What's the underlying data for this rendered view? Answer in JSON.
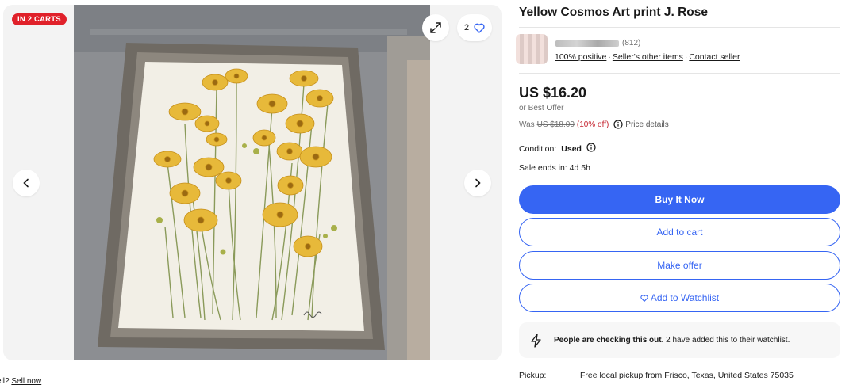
{
  "gallery": {
    "badge": "IN 2 CARTS",
    "watch_count": "2",
    "icons": {
      "expand": "expand-icon",
      "heart": "heart-icon",
      "prev": "chevron-left-icon",
      "next": "chevron-right-icon"
    }
  },
  "sell_note": {
    "prefix": "ell?",
    "link": "Sell now"
  },
  "listing": {
    "title": "Yellow Cosmos Art print J. Rose"
  },
  "seller": {
    "feedback_count": "(812)",
    "positive": "100% positive",
    "other_items": "Seller's other items",
    "contact": "Contact seller"
  },
  "pricing": {
    "price": "US $16.20",
    "best_offer": "or Best Offer",
    "was_label": "Was",
    "was_price": "US $18.00",
    "discount": "(10% off)",
    "details_link": "Price details"
  },
  "condition": {
    "label": "Condition:",
    "value": "Used"
  },
  "sale": {
    "label": "Sale ends in:",
    "value": "4d 5h"
  },
  "buttons": {
    "buy_now": "Buy It Now",
    "add_to_cart": "Add to cart",
    "make_offer": "Make offer",
    "watchlist": "Add to Watchlist"
  },
  "notice": {
    "bold": "People are checking this out.",
    "rest": "2 have added this to their watchlist."
  },
  "pickup": {
    "label": "Pickup:",
    "prefix": "Free local pickup from",
    "location": "Frisco, Texas, United States 75035"
  },
  "colors": {
    "accent": "#3665f3",
    "badge": "#e0212a",
    "discount": "#c4202c"
  }
}
